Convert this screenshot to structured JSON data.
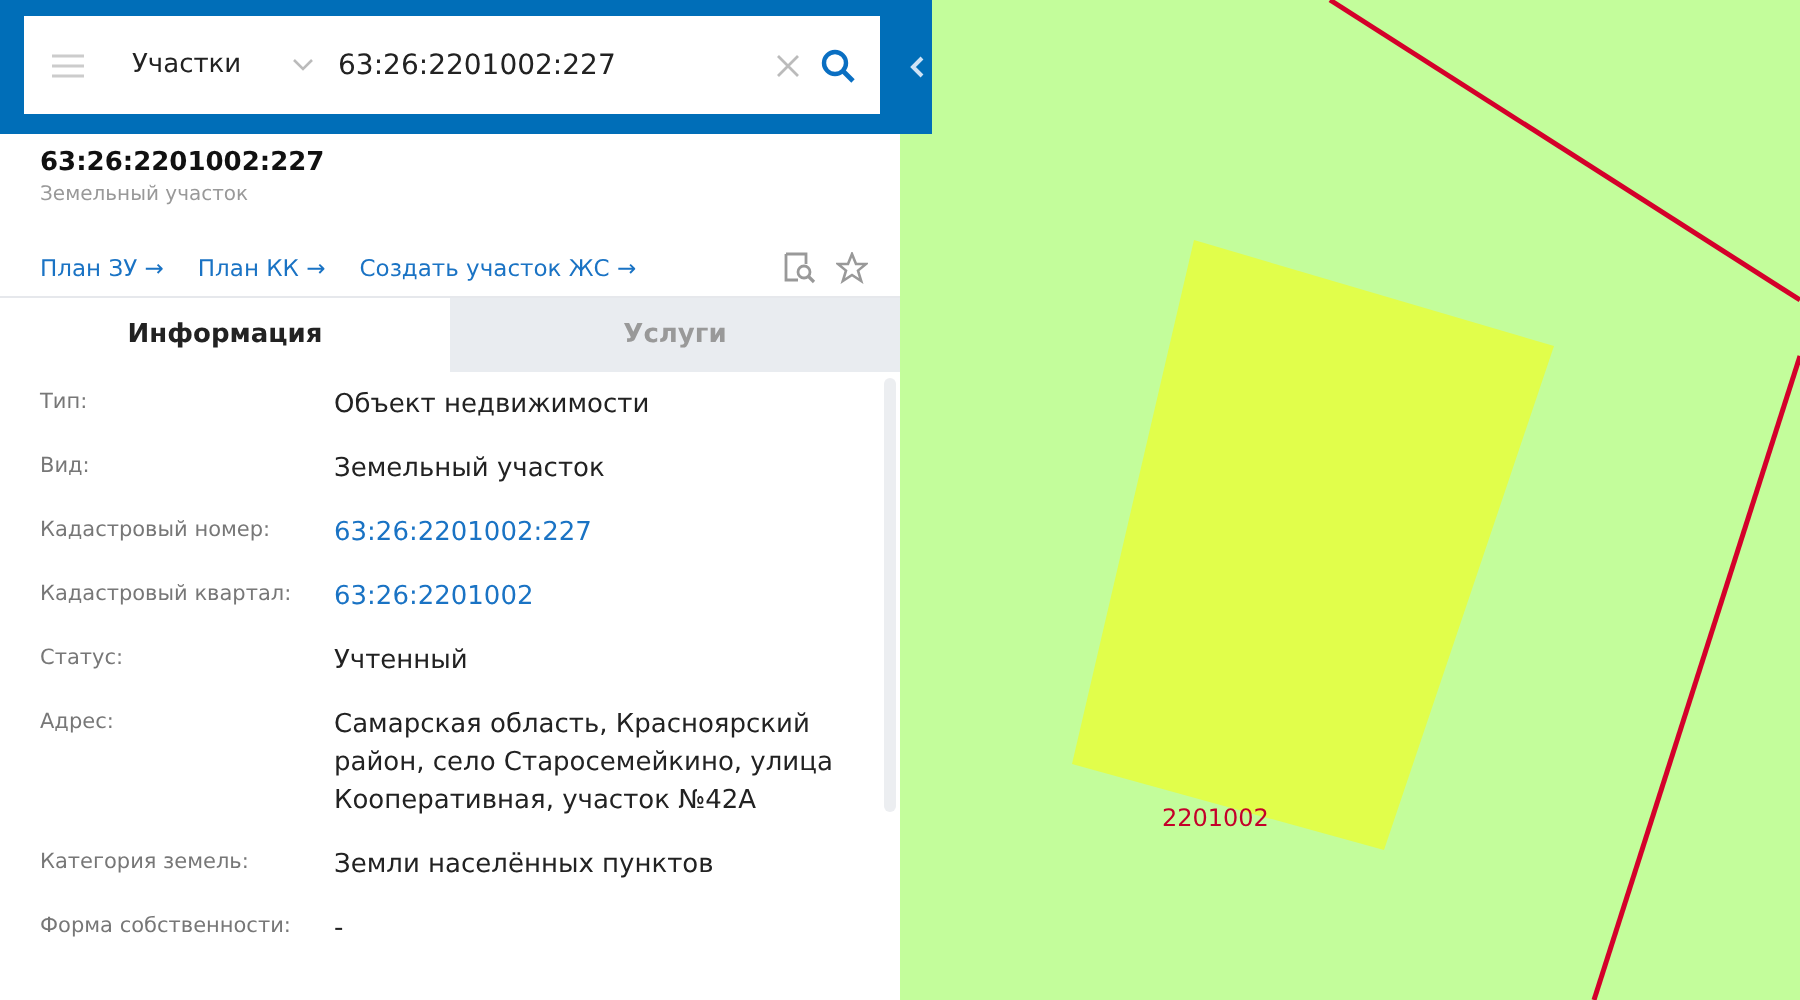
{
  "search": {
    "layer": "Участки",
    "query": "63:26:2201002:227"
  },
  "object": {
    "title": "63:26:2201002:227",
    "subtitle": "Земельный участок"
  },
  "links": [
    "План ЗУ →",
    "План КК →",
    "Создать участок ЖС →"
  ],
  "favorite": false,
  "tabs": [
    {
      "label": "Информация",
      "selected": true
    },
    {
      "label": "Услуги",
      "selected": false
    }
  ],
  "rows": [
    {
      "label": "Тип:",
      "value": "Объект недвижимости",
      "kind": "text"
    },
    {
      "label": "Вид:",
      "value": "Земельный участок",
      "kind": "text"
    },
    {
      "label": "Кадастровый номер:",
      "value": "63:26:2201002:227",
      "kind": "link"
    },
    {
      "label": "Кадастровый квартал:",
      "value": "63:26:2201002",
      "kind": "link"
    },
    {
      "label": "Статус:",
      "value": "Учтенный",
      "kind": "text"
    },
    {
      "label": "Адрес:",
      "value": "Самарская область, Красноярский район, село Старосемейкино, улица Кооперативная, участок №42А",
      "kind": "text"
    },
    {
      "label": "Категория земель:",
      "value": "Земли населённых пунктов",
      "kind": "text"
    },
    {
      "label": "Форма собственности:",
      "value": "-",
      "kind": "text"
    }
  ],
  "map": {
    "quarter_label": "2201002"
  }
}
